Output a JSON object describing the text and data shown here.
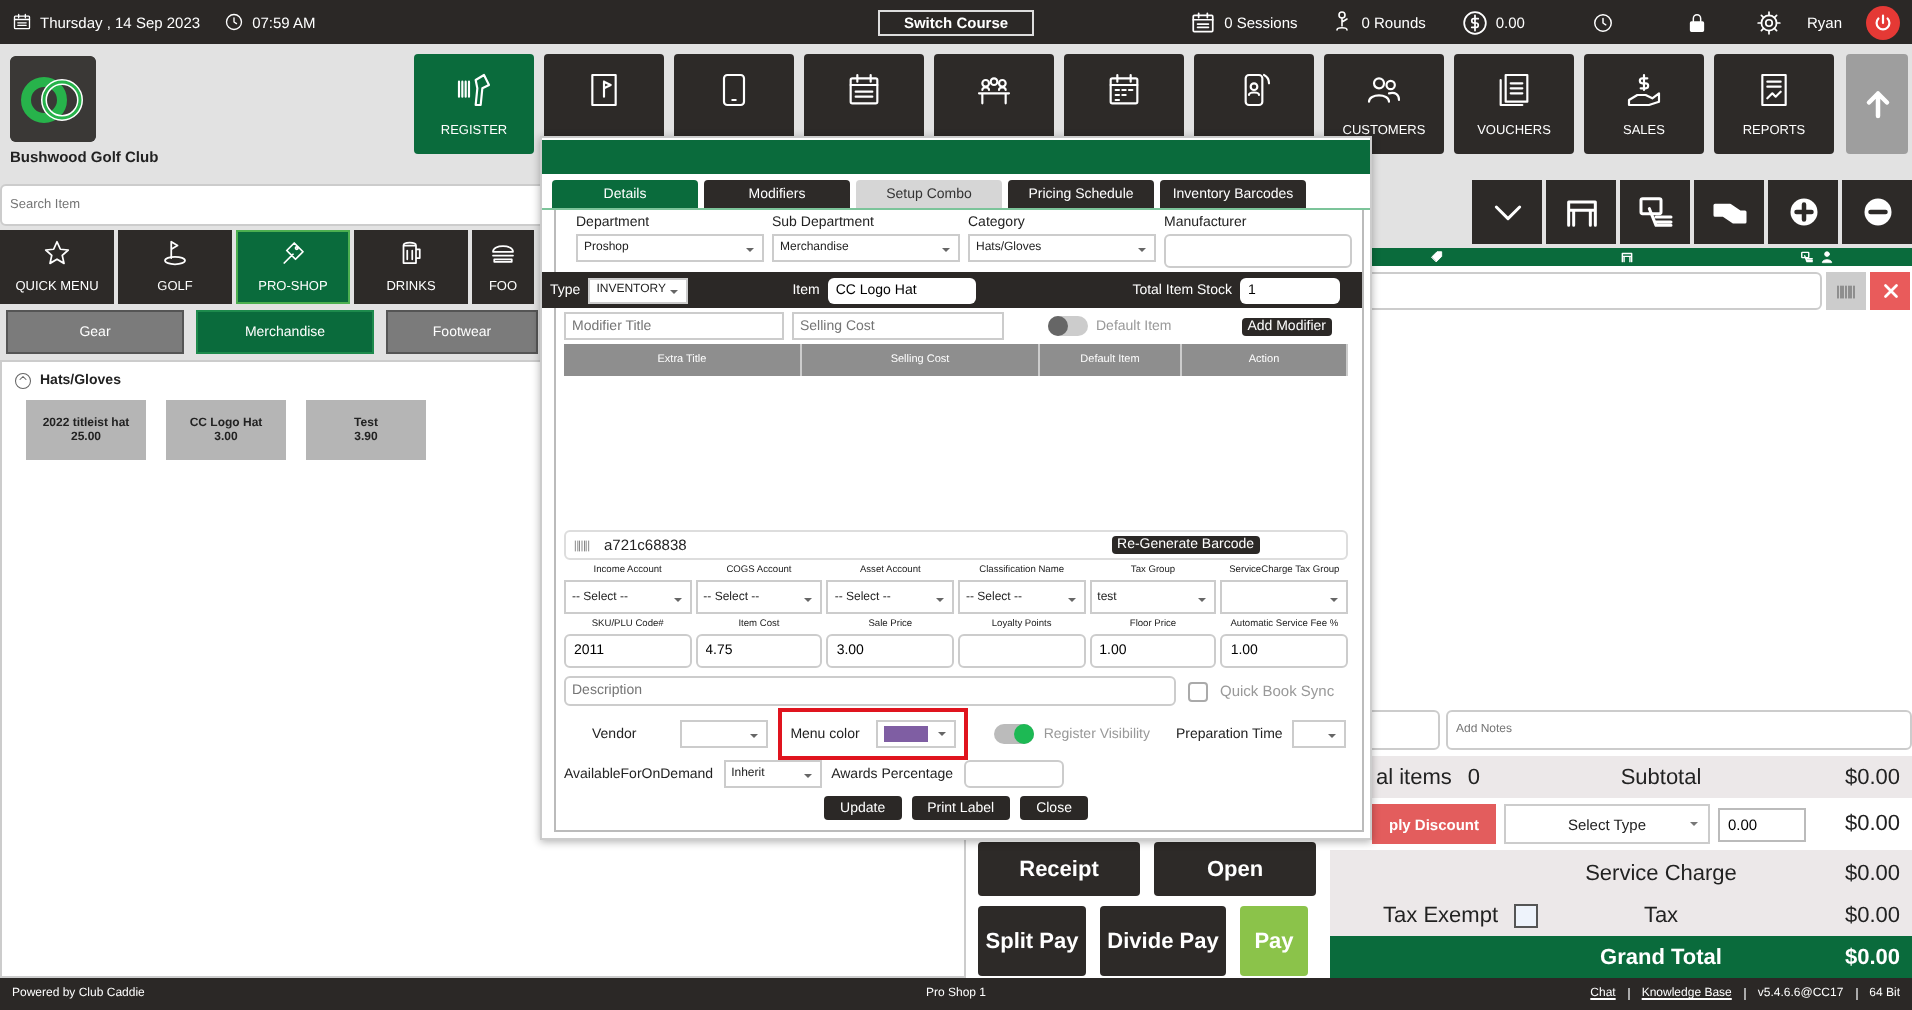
{
  "top_bar": {
    "date": "Thursday , 14 Sep 2023",
    "time": "07:59 AM",
    "switch_button": "Switch Course",
    "sessions": "0 Sessions",
    "rounds": "0 Rounds",
    "balance": "0.00",
    "user": "Ryan"
  },
  "club": {
    "name": "Bushwood Golf Club"
  },
  "nav": [
    {
      "kind": "scanner",
      "label": "REGISTER",
      "selected": true
    },
    {
      "kind": "board",
      "selected": false
    },
    {
      "kind": "tablet",
      "selected": false
    },
    {
      "kind": "list",
      "selected": false
    },
    {
      "kind": "meeting",
      "selected": false
    },
    {
      "kind": "calendar",
      "selected": false
    },
    {
      "kind": "phone",
      "selected": false
    },
    {
      "kind": "people",
      "label": "CUSTOMERS",
      "selected": false
    },
    {
      "kind": "voucher",
      "label": "VOUCHERS",
      "selected": false
    },
    {
      "kind": "sales",
      "label": "SALES",
      "selected": false
    },
    {
      "kind": "report",
      "label": "REPORTS",
      "selected": false
    },
    {
      "kind": "up",
      "selected": false
    }
  ],
  "search": {
    "placeholder": "Search Item"
  },
  "categories": [
    {
      "kind": "star",
      "label": "QUICK MENU",
      "selected": false
    },
    {
      "kind": "golf",
      "label": "GOLF",
      "selected": false
    },
    {
      "kind": "shop",
      "label": "PRO-SHOP",
      "selected": true
    },
    {
      "kind": "drink",
      "label": "DRINKS",
      "selected": false
    },
    {
      "kind": "food",
      "label": "FOO",
      "selected": false
    }
  ],
  "subcategories": [
    {
      "label": "Gear",
      "selected": false
    },
    {
      "label": "Merchandise",
      "selected": true
    },
    {
      "label": "Footwear",
      "selected": false
    }
  ],
  "group": {
    "title": "Hats/Gloves",
    "expanded": true,
    "items": [
      {
        "name": "2022 titleist hat",
        "price": "25.00"
      },
      {
        "name": "CC Logo Hat",
        "price": "3.00"
      },
      {
        "name": "Test",
        "price": "3.90"
      }
    ]
  },
  "modal": {
    "tabs": [
      {
        "label": "Details",
        "selected": true,
        "disabled": false
      },
      {
        "label": "Modifiers",
        "selected": false,
        "disabled": false
      },
      {
        "label": "Setup Combo",
        "selected": false,
        "disabled": true
      },
      {
        "label": "Pricing Schedule",
        "selected": false,
        "disabled": false
      },
      {
        "label": "Inventory Barcodes",
        "selected": false,
        "disabled": false
      }
    ],
    "classification": [
      {
        "label": "Department",
        "value": "Proshop",
        "kind": "select"
      },
      {
        "label": "Sub Department",
        "value": "Merchandise",
        "kind": "select"
      },
      {
        "label": "Category",
        "value": "Hats/Gloves",
        "kind": "select"
      },
      {
        "label": "Manufacturer",
        "kind": "text"
      }
    ],
    "type": {
      "label": "Type",
      "value": "INVENTORY"
    },
    "item": {
      "label": "Item",
      "value": "CC Logo Hat"
    },
    "stock": {
      "label": "Total Item Stock",
      "value": "1"
    },
    "modifier": {
      "title_placeholder": "Modifier Title",
      "cost_placeholder": "Selling Cost",
      "default_item": {
        "label": "Default Item",
        "on": false
      },
      "add_button": "Add Modifier",
      "columns": [
        "Extra Title",
        "Selling Cost",
        "Default Item",
        "Action"
      ]
    },
    "barcode": {
      "value": "a721c68838",
      "button": "Re-Generate Barcode"
    },
    "accounts": [
      {
        "label": "Income Account",
        "value": "-- Select --"
      },
      {
        "label": "COGS Account",
        "value": "-- Select --"
      },
      {
        "label": "Asset Account",
        "value": "-- Select --"
      },
      {
        "label": "Classification Name",
        "value": "-- Select --"
      },
      {
        "label": "Tax Group",
        "value": "test"
      },
      {
        "label": "ServiceCharge Tax Group"
      }
    ],
    "pricing": [
      {
        "label": "SKU/PLU Code#",
        "value": "2011"
      },
      {
        "label": "Item Cost",
        "value": "4.75"
      },
      {
        "label": "Sale Price",
        "value": "3.00"
      },
      {
        "label": "Loyalty Points"
      },
      {
        "label": "Floor Price",
        "value": "1.00"
      },
      {
        "label": "Automatic Service Fee %",
        "value": "1.00"
      }
    ],
    "description": {
      "placeholder": "Description"
    },
    "quick_book_sync": {
      "label": "Quick Book Sync",
      "checked": false
    },
    "vendor": {
      "label": "Vendor"
    },
    "menu_color": {
      "label": "Menu color",
      "color": "#7f5ea3",
      "highlighted": true
    },
    "register_visibility": {
      "label": "Register Visibility",
      "on": true
    },
    "preparation_time": {
      "label": "Preparation Time"
    },
    "on_demand": {
      "label": "AvailableForOnDemand",
      "value": "Inherit"
    },
    "awards": {
      "label": "Awards Percentage"
    },
    "buttons": [
      "Update",
      "Print Label",
      "Close"
    ]
  },
  "order": {
    "tools": [
      {
        "kind": "chevron"
      },
      {
        "kind": "seat"
      },
      {
        "kind": "card"
      },
      {
        "kind": "hand"
      },
      {
        "kind": "plus"
      },
      {
        "kind": "minus"
      }
    ],
    "notes": {
      "placeholder": "Add Notes"
    },
    "totals": {
      "items_label": "al items",
      "items_count": "0",
      "subtotal_label": "Subtotal",
      "subtotal": "$0.00",
      "discount_button": "ply Discount",
      "discount_type": "Select Type",
      "discount_value": "0.00",
      "discount": "$0.00",
      "service_charge_label": "Service Charge",
      "service_charge": "$0.00",
      "tax_exempt": {
        "label": "Tax Exempt",
        "checked": false
      },
      "tax_label": "Tax",
      "tax": "$0.00",
      "grand_total_label": "Grand Total",
      "grand_total": "$0.00"
    },
    "actions": [
      {
        "label": "Receipt",
        "kind": "dark"
      },
      {
        "label": "Open",
        "kind": "dark"
      },
      {
        "label": "Split Pay",
        "kind": "dark"
      },
      {
        "label": "Divide Pay",
        "kind": "dark"
      },
      {
        "label": "Pay",
        "kind": "pay"
      }
    ]
  },
  "status_bar": {
    "left": "Powered by Club Caddie",
    "center": "Pro Shop 1",
    "links": [
      "Chat",
      "Knowledge Base"
    ],
    "version": "v5.4.6.6@CC17",
    "bits": "64 Bit"
  }
}
